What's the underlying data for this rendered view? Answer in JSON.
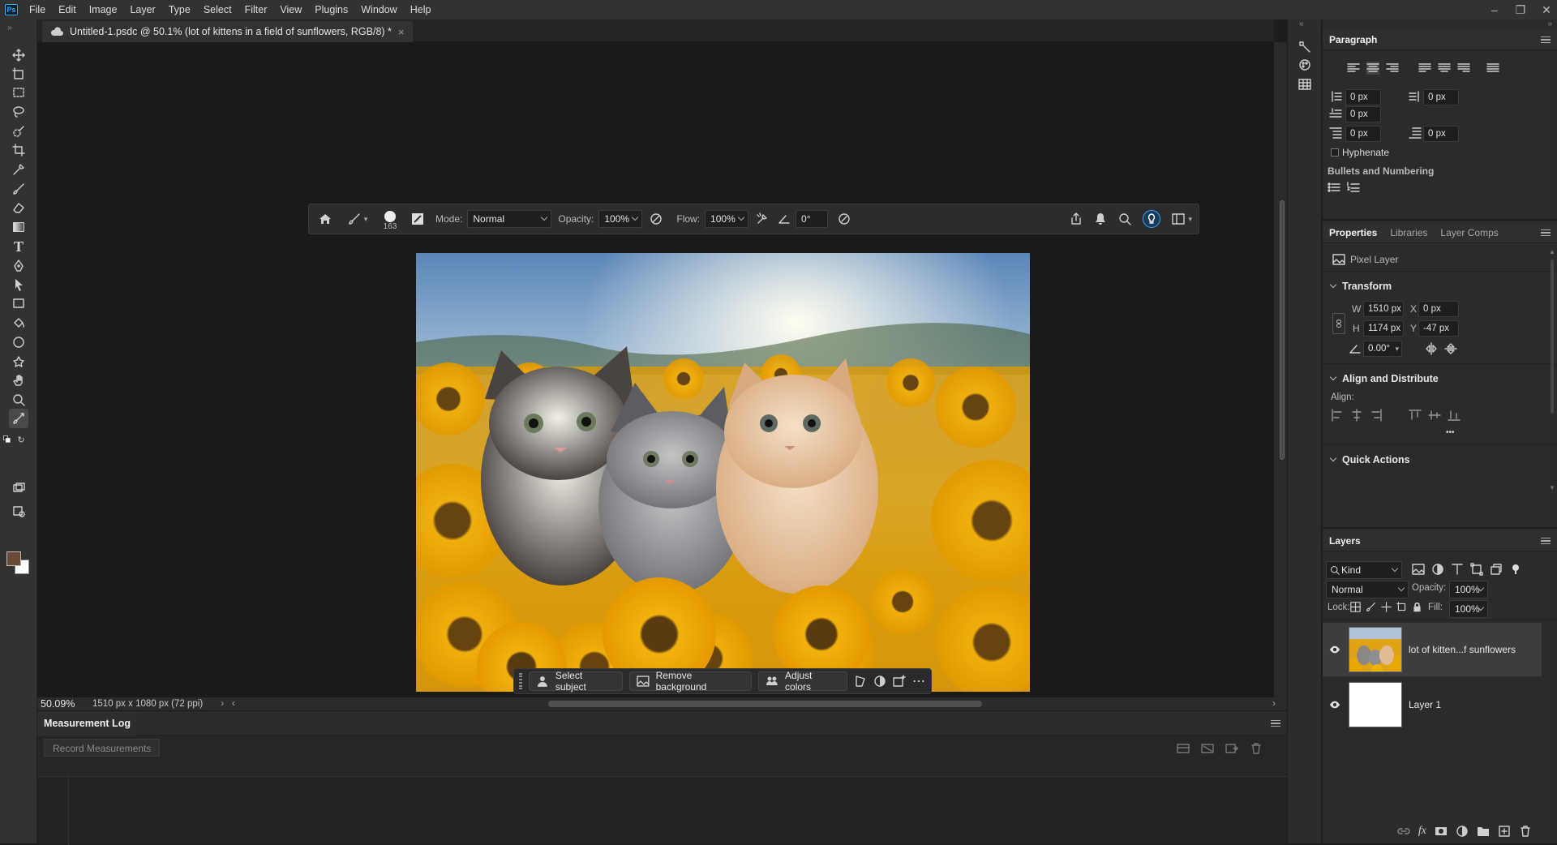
{
  "app": {
    "logo": "Ps"
  },
  "menu": [
    "File",
    "Edit",
    "Image",
    "Layer",
    "Type",
    "Select",
    "Filter",
    "View",
    "Plugins",
    "Window",
    "Help"
  ],
  "document_tab": {
    "title": "Untitled-1.psdc @ 50.1% (lot of kittens in a field of sunflowers, RGB/8) *",
    "close": "×"
  },
  "options_bar": {
    "brush_size": "163",
    "mode_label": "Mode:",
    "mode_value": "Normal",
    "opacity_label": "Opacity:",
    "opacity_value": "100%",
    "flow_label": "Flow:",
    "flow_value": "100%",
    "angle_value": "0°"
  },
  "contextual_task_bar": {
    "select_subject": "Select subject",
    "remove_background": "Remove background",
    "adjust_colors": "Adjust colors"
  },
  "status": {
    "zoom": "50.09%",
    "doc_info": "1510 px x 1080 px (72 ppi)"
  },
  "measurement_log": {
    "title": "Measurement Log",
    "record": "Record Measurements"
  },
  "paragraph": {
    "title": "Paragraph",
    "indent_left": "0 px",
    "indent_right": "0 px",
    "indent_first": "0 px",
    "space_before": "0 px",
    "space_after": "0 px",
    "hyphenate": "Hyphenate",
    "bullets": "Bullets and Numbering"
  },
  "properties": {
    "tabs": [
      "Properties",
      "Libraries",
      "Layer Comps"
    ],
    "layer_type": "Pixel Layer",
    "transform": "Transform",
    "w_label": "W",
    "w": "1510 px",
    "x_label": "X",
    "x": "0 px",
    "h_label": "H",
    "h": "1174 px",
    "y_label": "Y",
    "y": "-47 px",
    "angle": "0.00°",
    "align_distribute": "Align and Distribute",
    "align_label": "Align:",
    "more": "•••",
    "quick_actions": "Quick Actions"
  },
  "layers": {
    "title": "Layers",
    "kind": "Kind",
    "blend": "Normal",
    "opacity_label": "Opacity:",
    "opacity": "100%",
    "lock_label": "Lock:",
    "fill_label": "Fill:",
    "fill": "100%",
    "items": [
      {
        "name": "lot of kitten...f sunflowers",
        "selected": true
      },
      {
        "name": "Layer 1",
        "selected": false
      }
    ]
  },
  "colors": {
    "foreground": "#6a4a36",
    "background": "#ffffff",
    "accent": "#31a8ff"
  }
}
